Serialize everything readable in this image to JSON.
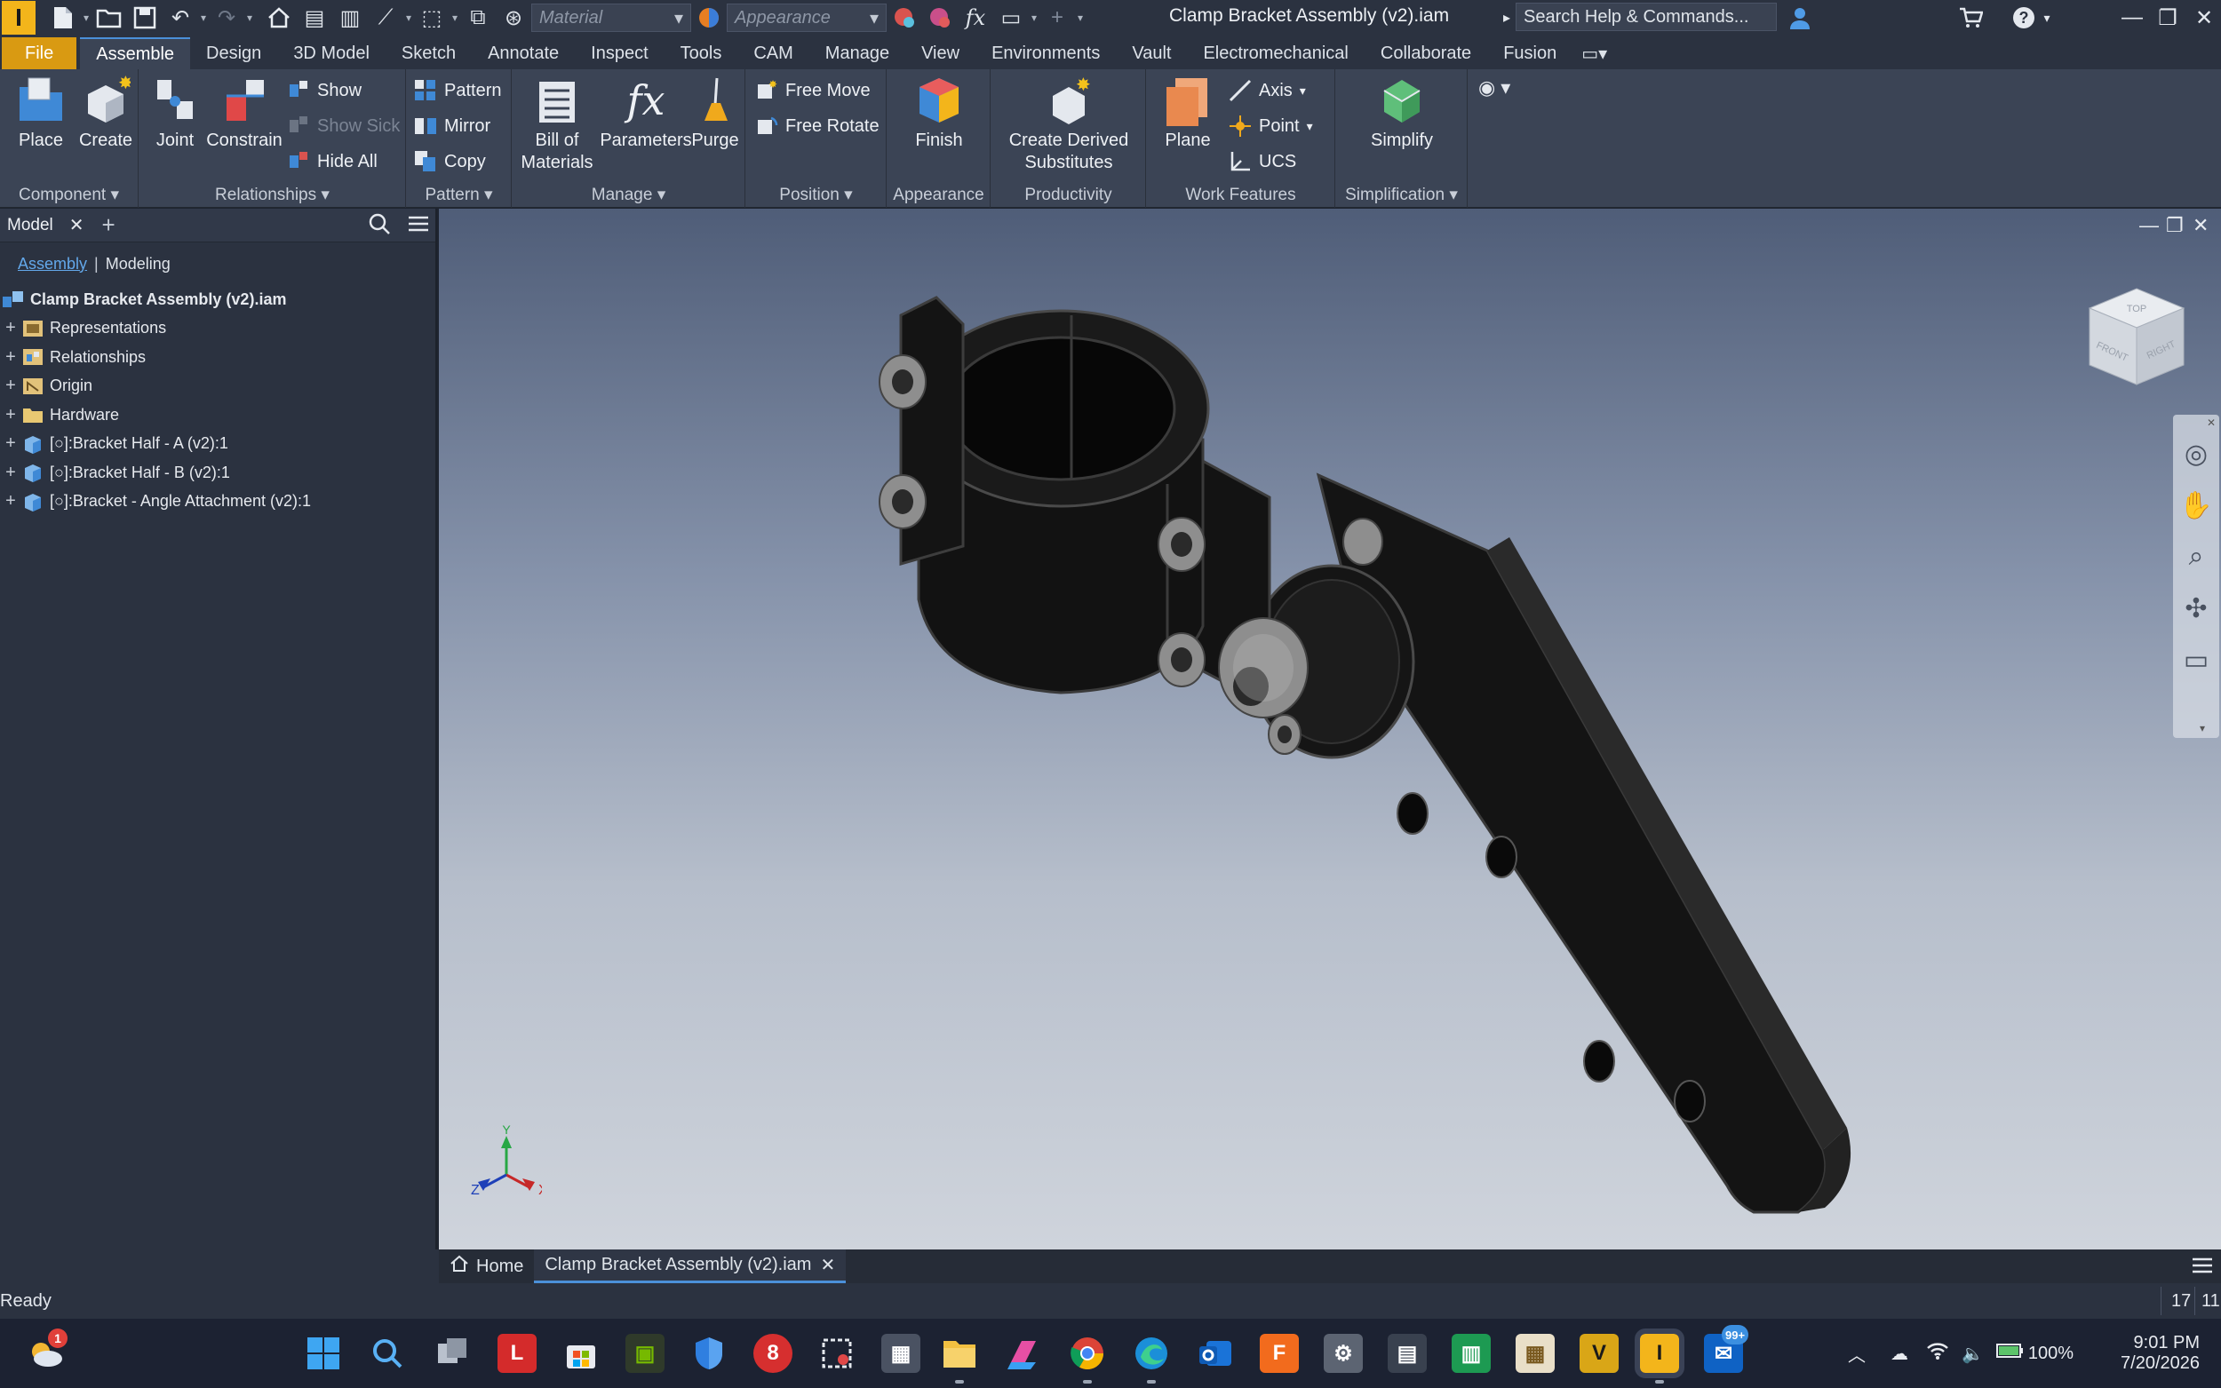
{
  "app": {
    "window_title": "Clamp Bracket Assembly (v2).iam",
    "material_placeholder": "Material",
    "appearance_placeholder": "Appearance",
    "search_placeholder": "Search Help & Commands..."
  },
  "ribbon_tabs": [
    "File",
    "Assemble",
    "Design",
    "3D Model",
    "Sketch",
    "Annotate",
    "Inspect",
    "Tools",
    "CAM",
    "Manage",
    "View",
    "Environments",
    "Vault",
    "Electromechanical",
    "Collaborate",
    "Fusion"
  ],
  "ribbon": {
    "component": {
      "label": "Component",
      "place": "Place",
      "create": "Create"
    },
    "relationships": {
      "label": "Relationships",
      "joint": "Joint",
      "constrain": "Constrain",
      "show": "Show",
      "show_sick": "Show Sick",
      "hide_all": "Hide All"
    },
    "pattern": {
      "label": "Pattern",
      "pattern": "Pattern",
      "mirror": "Mirror",
      "copy": "Copy"
    },
    "manage": {
      "label": "Manage",
      "bom_line1": "Bill of",
      "bom_line2": "Materials",
      "parameters": "Parameters",
      "purge": "Purge"
    },
    "position": {
      "label": "Position",
      "free_move": "Free Move",
      "free_rotate": "Free Rotate"
    },
    "appearance": {
      "label": "Appearance",
      "finish": "Finish"
    },
    "productivity": {
      "label": "Productivity",
      "derived_line1": "Create Derived",
      "derived_line2": "Substitutes"
    },
    "work_features": {
      "label": "Work Features",
      "plane": "Plane",
      "axis": "Axis",
      "point": "Point",
      "ucs": "UCS"
    },
    "simplification": {
      "label": "Simplification",
      "simplify": "Simplify"
    }
  },
  "browser": {
    "tab": "Model",
    "subtabs": [
      "Assembly",
      "Modeling"
    ],
    "root": "Clamp Bracket Assembly (v2).iam",
    "nodes": [
      "Representations",
      "Relationships",
      "Origin",
      "Hardware",
      "[○]:Bracket Half - A (v2):1",
      "[○]:Bracket Half - B (v2):1",
      "[○]:Bracket - Angle Attachment (v2):1"
    ]
  },
  "viewcube": {
    "top": "TOP",
    "front": "FRONT",
    "right": "RIGHT"
  },
  "triad": {
    "x": "X",
    "y": "Y",
    "z": "Z"
  },
  "doc_tabs": {
    "home": "Home",
    "document": "Clamp Bracket Assembly (v2).iam"
  },
  "status": {
    "text": "Ready",
    "count1": "17",
    "count2": "11"
  },
  "taskbar": {
    "weather_badge": "1",
    "outlook_badge": "99+",
    "battery": "100%",
    "time": "9:01 PM",
    "date": "7/20/2026"
  },
  "colors": {
    "accent": "#4b90d9",
    "file_tab": "#d99a12",
    "app_logo": "#f3b51b"
  }
}
